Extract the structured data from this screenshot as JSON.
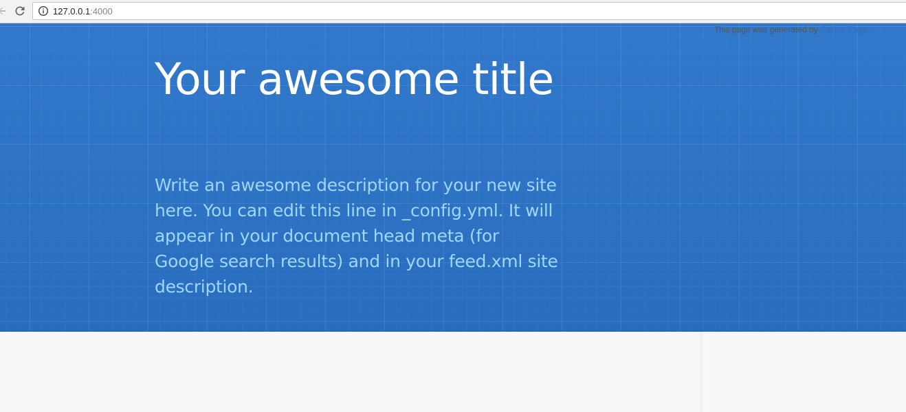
{
  "browser": {
    "url_host": "127.0.0.1",
    "url_port": ":4000",
    "back_icon": "arrow-left-icon",
    "reload_icon": "reload-icon",
    "info_icon": "info-icon"
  },
  "header": {
    "title": "Your awesome title",
    "description": "Write an awesome description for your new site here. You can edit this line in _config.yml. It will appear in your document head meta (for Google search results) and in your feed.xml site description.",
    "background_color": "#2b74c9",
    "title_color": "#ffffff",
    "description_color": "#9fd6ff"
  },
  "footer": {
    "credits_prefix": "This page was generated by ",
    "credits_link": "GitHub Pages",
    "credits_suffix": "."
  }
}
